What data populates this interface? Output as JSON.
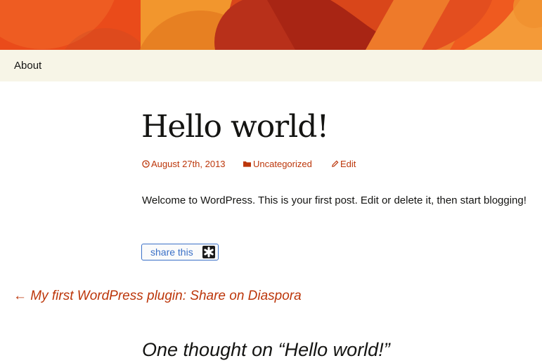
{
  "nav": {
    "items": [
      {
        "label": "About"
      }
    ]
  },
  "post": {
    "title": "Hello world!",
    "date": "August 27th, 2013",
    "category": "Uncategorized",
    "edit_label": "Edit",
    "content": "Welcome to WordPress. This is your first post. Edit or delete it, then start blogging!",
    "share_label": "share this"
  },
  "post_navigation": {
    "prev_label": "← My first WordPress plugin: Share on Diaspora"
  },
  "comments": {
    "title": "One thought on “Hello world!”"
  },
  "colors": {
    "accent": "#bc360a",
    "nav_background": "#f7f5e7",
    "share_blue": "#3a70c7",
    "text": "#141412"
  },
  "icons": {
    "date": "clock-icon",
    "category": "folder-icon",
    "edit": "pencil-icon",
    "share": "diaspora-asterisk-icon"
  }
}
